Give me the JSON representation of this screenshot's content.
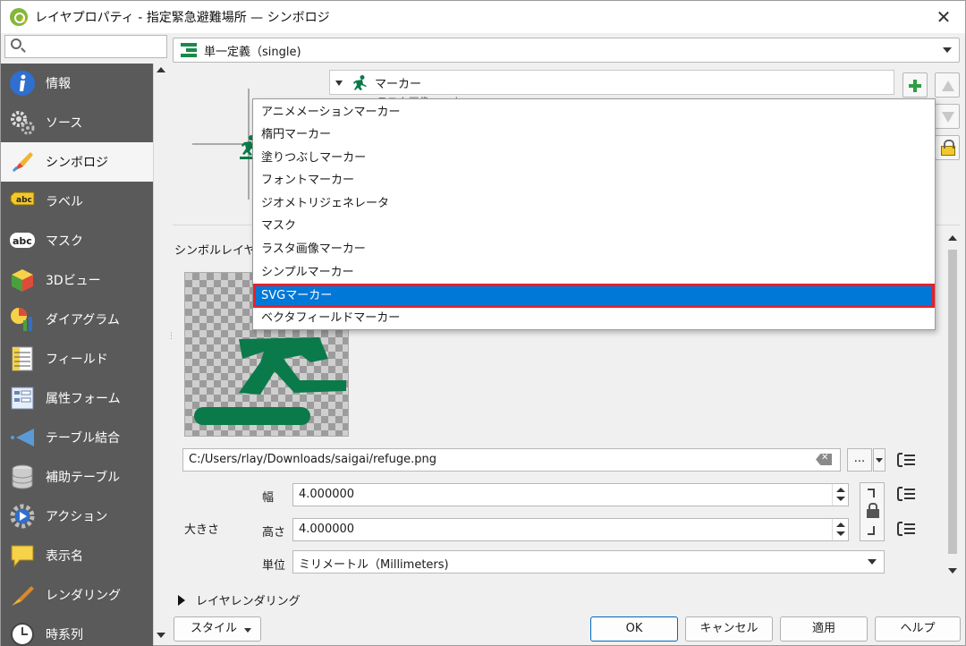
{
  "window": {
    "title": "レイヤプロパティ - 指定緊急避難場所 — シンボロジ",
    "close_label": "✕"
  },
  "sidebar": {
    "search_placeholder": "",
    "items": [
      {
        "label": "情報",
        "icon": "info-icon"
      },
      {
        "label": "ソース",
        "icon": "source-gear-icon"
      },
      {
        "label": "シンボロジ",
        "icon": "symbology-brush-icon"
      },
      {
        "label": "ラベル",
        "icon": "label-abc-icon"
      },
      {
        "label": "マスク",
        "icon": "mask-abc-icon"
      },
      {
        "label": "3Dビュー",
        "icon": "cube-3d-icon"
      },
      {
        "label": "ダイアグラム",
        "icon": "diagram-icon"
      },
      {
        "label": "フィールド",
        "icon": "fields-icon"
      },
      {
        "label": "属性フォーム",
        "icon": "attribute-form-icon"
      },
      {
        "label": "テーブル結合",
        "icon": "join-icon"
      },
      {
        "label": "補助テーブル",
        "icon": "auxiliary-storage-icon"
      },
      {
        "label": "アクション",
        "icon": "action-gear-icon"
      },
      {
        "label": "表示名",
        "icon": "display-speech-icon"
      },
      {
        "label": "レンダリング",
        "icon": "rendering-brush-icon"
      },
      {
        "label": "時系列",
        "icon": "clock-icon"
      }
    ],
    "active_index": 2
  },
  "renderer": {
    "label": "単一定義（single)"
  },
  "symbol_tree": {
    "root_label": "マーカー",
    "child_label": "ラスタ画像マーカー"
  },
  "symbol_layer_type_label": "シンボルレイヤ型",
  "dropdown": {
    "items": [
      "アニメメーションマーカー",
      "楕円マーカー",
      "塗りつぶしマーカー",
      "フォントマーカー",
      "ジオメトリジェネレータ",
      "マスク",
      "ラスタ画像マーカー",
      "シンプルマーカー",
      "SVGマーカー",
      "ベクタフィールドマーカー"
    ],
    "selected_index": 8,
    "highlight_color": "#0078d7",
    "annotation_color": "#e8202a"
  },
  "image": {
    "path": "C:/Users/rlay/Downloads/saigai/refuge.png",
    "browse_label": "...",
    "symbol_color": "#0a7a4a"
  },
  "size": {
    "group_label": "大きさ",
    "width_label": "幅",
    "width_value": "4.000000",
    "height_label": "高さ",
    "height_value": "4.000000",
    "unit_label": "単位",
    "unit_value": "ミリメートル（Millimeters)"
  },
  "layer_rendering_label": "レイヤレンダリング",
  "buttons": {
    "style": "スタイル",
    "ok": "OK",
    "cancel": "キャンセル",
    "apply": "適用",
    "help": "ヘルプ"
  }
}
